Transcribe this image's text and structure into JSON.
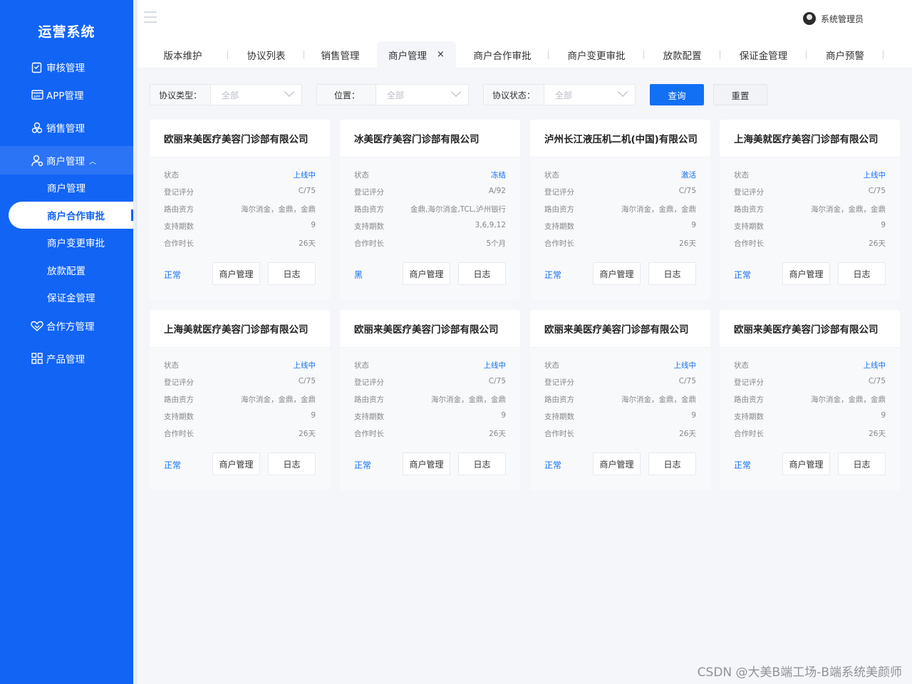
{
  "app": {
    "title": "运营系统"
  },
  "sidebar": {
    "items": [
      {
        "label": "审核管理",
        "icon": "clipboard-icon"
      },
      {
        "label": "APP管理",
        "icon": "app-icon"
      },
      {
        "label": "销售管理",
        "icon": "sales-icon"
      },
      {
        "label": "商户管理",
        "icon": "merchant-icon"
      },
      {
        "label": "合作方管理",
        "icon": "handshake-icon"
      },
      {
        "label": "产品管理",
        "icon": "grid-icon"
      }
    ],
    "sub_items": [
      "商户管理",
      "商户合作审批",
      "商户变更审批",
      "放款配置",
      "保证金管理"
    ],
    "active_sub": "商户合作审批",
    "accent": "#1264f5"
  },
  "header": {
    "user": "系统管理员"
  },
  "tabs": [
    "版本维护",
    "协议列表",
    "销售管理",
    "商户管理",
    "商户合作审批",
    "商户变更审批",
    "放款配置",
    "保证金管理",
    "商户预警"
  ],
  "active_tab": "商户管理",
  "filters": [
    {
      "label": "协议类型：",
      "value": "全部"
    },
    {
      "label": "位置：",
      "value": "全部"
    },
    {
      "label": "协议状态：",
      "value": "全部"
    }
  ],
  "buttons": {
    "search": "查询",
    "reset": "重置"
  },
  "card_fields": [
    "状态",
    "登记评分",
    "路由资方",
    "支持期数",
    "合作时长"
  ],
  "card_actions": [
    "商户管理",
    "日志"
  ],
  "cards": [
    {
      "name": "欧丽来美医疗美容门诊部有限公司",
      "state": "上线中",
      "score": "C/75",
      "funder": "海尔消金，金鼎，金鼎",
      "terms": "9",
      "duration": "26天",
      "status": "正常"
    },
    {
      "name": "冰美医疗美容门诊部有限公司",
      "state": "冻结",
      "score": "A/92",
      "funder": "金鼎,海尔消金,TCL,泸州银行",
      "terms": "3,6,9,12",
      "duration": "5个月",
      "status": "黑"
    },
    {
      "name": "泸州长江液压机二机(中国)有限公司",
      "state": "激活",
      "score": "C/75",
      "funder": "海尔消金，金鼎，金鼎",
      "terms": "9",
      "duration": "26天",
      "status": "正常"
    },
    {
      "name": "上海美就医疗美容门诊部有限公司",
      "state": "上线中",
      "score": "C/75",
      "funder": "海尔消金，金鼎，金鼎",
      "terms": "9",
      "duration": "26天",
      "status": "正常"
    },
    {
      "name": "上海美就医疗美容门诊部有限公司",
      "state": "上线中",
      "score": "C/75",
      "funder": "海尔消金，金鼎，金鼎",
      "terms": "9",
      "duration": "26天",
      "status": "正常"
    },
    {
      "name": "欧丽来美医疗美容门诊部有限公司",
      "state": "上线中",
      "score": "C/75",
      "funder": "海尔消金，金鼎，金鼎",
      "terms": "9",
      "duration": "26天",
      "status": "正常"
    },
    {
      "name": "欧丽来美医疗美容门诊部有限公司",
      "state": "上线中",
      "score": "C/75",
      "funder": "海尔消金，金鼎，金鼎",
      "terms": "9",
      "duration": "26天",
      "status": "正常"
    },
    {
      "name": "欧丽来美医疗美容门诊部有限公司",
      "state": "上线中",
      "score": "C/75",
      "funder": "海尔消金，金鼎，金鼎",
      "terms": "9",
      "duration": "26天",
      "status": "正常"
    }
  ],
  "watermark": "CSDN @大美B端工场-B端系统美颜师"
}
